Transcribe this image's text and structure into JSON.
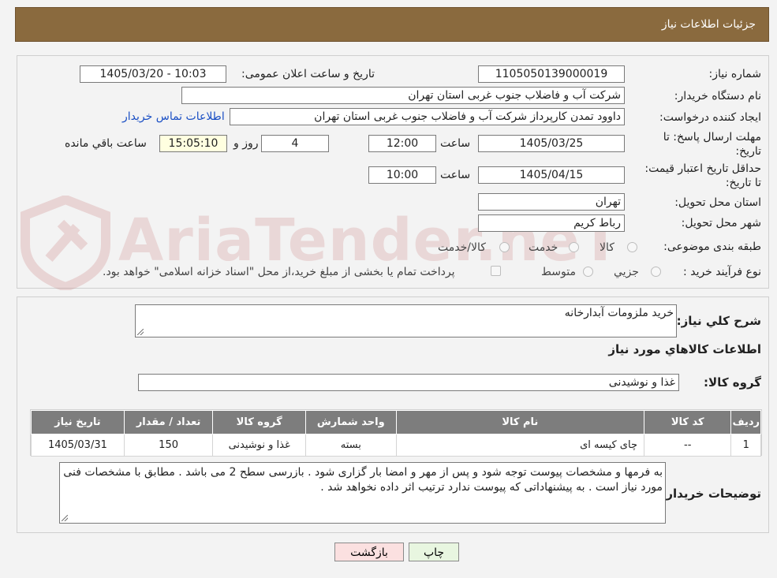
{
  "header": {
    "title": "جزئیات اطلاعات نیاز"
  },
  "watermark": {
    "text": "AriaTender.neT"
  },
  "form": {
    "need_number": {
      "label": "شماره نیاز:",
      "value": "1105050139000019"
    },
    "announce_datetime": {
      "label": "تاریخ و ساعت اعلان عمومی:",
      "value": "1405/03/20 - 10:03"
    },
    "buyer_org": {
      "label": "نام دستگاه خریدار:",
      "value": "شرکت آب و فاضلاب جنوب غربی استان تهران"
    },
    "requester": {
      "label": "ایجاد کننده درخواست:",
      "value": "داوود  تمدن  کارپرداز شرکت آب و فاضلاب جنوب غربی استان تهران",
      "contact_link": "اطلاعات تماس خریدار"
    },
    "reply_deadline": {
      "label": "مهلت ارسال پاسخ: تا تاریخ:",
      "date": "1405/03/25",
      "time_label": "ساعت",
      "time": "12:00",
      "days": "4",
      "days_label": "روز و",
      "remaining": "15:05:10",
      "remaining_label": "ساعت باقي مانده"
    },
    "price_validity": {
      "label": "حداقل تاریخ اعتبار قیمت: تا تاریخ:",
      "date": "1405/04/15",
      "time_label": "ساعت",
      "time": "10:00"
    },
    "delivery_province": {
      "label": "استان محل تحویل:",
      "value": "تهران"
    },
    "delivery_city": {
      "label": "شهر محل تحویل:",
      "value": "رباط کریم"
    },
    "category": {
      "label": "طبقه بندی موضوعی:",
      "options": [
        "کالا",
        "خدمت",
        "کالا/خدمت"
      ]
    },
    "purchase_type": {
      "label": "نوع فرآیند خرید :",
      "options": [
        "جزیي",
        "متوسط"
      ],
      "payment_note": "پرداخت تمام یا بخشی از مبلغ خرید،از محل \"اسناد خزانه اسلامی\" خواهد بود."
    }
  },
  "details": {
    "summary_label": "شرح كلي نياز:",
    "summary_value": "خرید ملزومات آبدارخانه",
    "goods_info_title": "اطلاعات كالاهاي مورد نياز",
    "goods_group_label": "گروه كالا:",
    "goods_group_value": "غذا و نوشیدنی",
    "table": {
      "headers": [
        "رديف",
        "كد كالا",
        "نام كالا",
        "واحد شمارش",
        "گروه كالا",
        "تعداد / مقدار",
        "تاريخ نياز"
      ],
      "rows": [
        [
          "1",
          "--",
          "چای کیسه ای",
          "بسته",
          "غذا و نوشیدنی",
          "150",
          "1405/03/31"
        ]
      ]
    },
    "buyer_notes_label": "توضيحات خريدار:",
    "buyer_notes_value": "به فرمها و مشخصات پیوست توجه شود و پس از مهر و امضا بار گزاری شود . بازرسی سطح 2 می باشد . مطابق با مشخصات فنی مورد نیاز است .  به پیشنهاداتی که پیوست ندارد ترتیب اثر داده نخواهد شد ."
  },
  "buttons": {
    "print": "چاپ",
    "back": "بازگشت"
  },
  "colors": {
    "header_bg": "#8a6a3e",
    "link": "#1a4fc4",
    "table_header": "#7d7d7d",
    "print_btn": "#e8f6e0",
    "back_btn": "#fbe0e0"
  }
}
